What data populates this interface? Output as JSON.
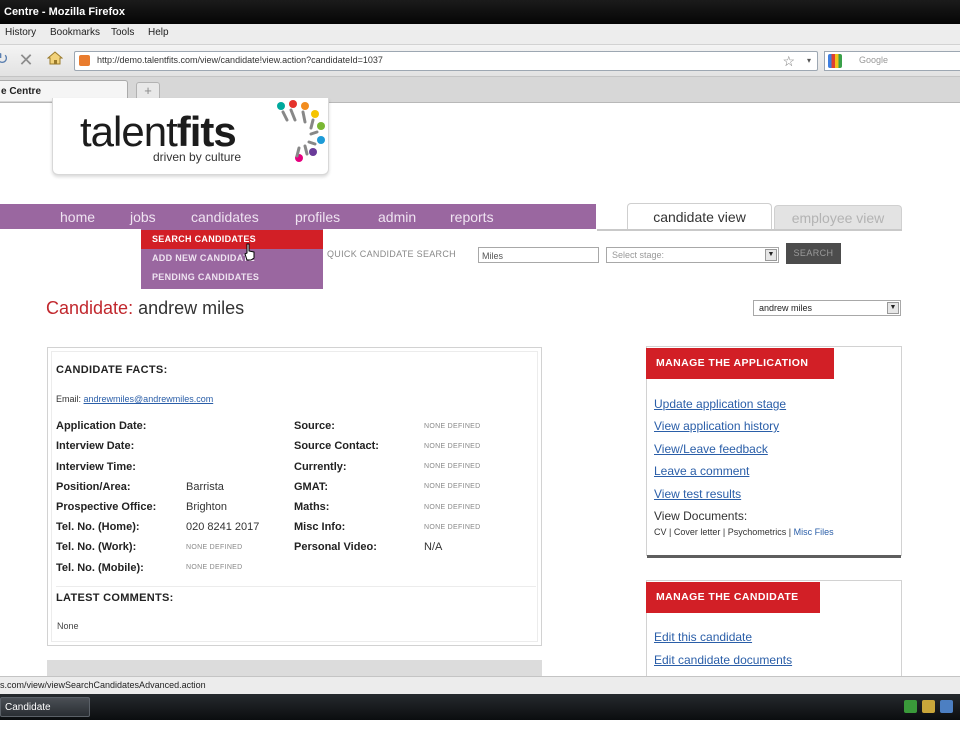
{
  "browser": {
    "title": "Centre - Mozilla Firefox",
    "menu": [
      "History",
      "Bookmarks",
      "Tools",
      "Help"
    ],
    "url": "http://demo.talentfits.com/view/candidate!view.action?candidateId=1037",
    "search_placeholder": "Google",
    "tab_label": "e Centre",
    "new_tab": "+",
    "status_text": "s.com/view/viewSearchCandidatesAdvanced.action",
    "taskbar_item": "Candidate Centre..."
  },
  "logo": {
    "name_light": "talent",
    "name_bold": "fits",
    "tagline": "driven by culture"
  },
  "nav": {
    "items": [
      "home",
      "jobs",
      "candidates",
      "profiles",
      "admin",
      "reports"
    ],
    "dropdown": [
      "SEARCH CANDIDATES",
      "ADD NEW CANDIDATE",
      "PENDING CANDIDATES"
    ]
  },
  "views": {
    "active": "candidate view",
    "inactive": "employee view"
  },
  "quick_search": {
    "label": "QUICK CANDIDATE SEARCH",
    "value": "Miles",
    "stage_placeholder": "Select stage:",
    "button": "SEARCH"
  },
  "candidate": {
    "label": "Candidate:",
    "name": "andrew miles",
    "selector_value": "andrew miles"
  },
  "facts": {
    "heading": "CANDIDATE FACTS:",
    "email_label": "Email:",
    "email": "andrewmiles@andrewmiles.com",
    "left": [
      {
        "label": "Application Date:",
        "value": ""
      },
      {
        "label": "Interview Date:",
        "value": ""
      },
      {
        "label": "Interview Time:",
        "value": ""
      },
      {
        "label": "Position/Area:",
        "value": "Barrista"
      },
      {
        "label": "Prospective Office:",
        "value": "Brighton"
      },
      {
        "label": "Tel. No. (Home):",
        "value": "020 8241 2017"
      },
      {
        "label": "Tel. No. (Work):",
        "value": "NONE DEFINED"
      },
      {
        "label": "Tel. No. (Mobile):",
        "value": "NONE DEFINED"
      }
    ],
    "right": [
      {
        "label": "Source:",
        "value": "NONE DEFINED"
      },
      {
        "label": "Source Contact:",
        "value": "NONE DEFINED"
      },
      {
        "label": "Currently:",
        "value": "NONE DEFINED"
      },
      {
        "label": "GMAT:",
        "value": "NONE DEFINED"
      },
      {
        "label": "Maths:",
        "value": "NONE DEFINED"
      },
      {
        "label": "Misc Info:",
        "value": "NONE DEFINED"
      },
      {
        "label": "Personal Video:",
        "value": "N/A"
      }
    ],
    "comments_heading": "LATEST COMMENTS:",
    "comments_value": "None"
  },
  "manage_application": {
    "heading": "MANAGE THE APPLICATION",
    "links": [
      "Update application stage",
      "View application history",
      "View/Leave feedback",
      "Leave a comment",
      "View test results"
    ],
    "docs_label": "View Documents:",
    "docs": [
      "CV",
      "Cover letter",
      "Psychometrics",
      "Misc Files"
    ],
    "docs_sep": " | "
  },
  "manage_candidate": {
    "heading": "MANAGE THE CANDIDATE",
    "links": [
      "Edit this candidate",
      "Edit candidate documents"
    ]
  },
  "colors": {
    "nav_purple": "#9a67a0",
    "accent_red": "#d21f26",
    "candidate_label_red": "#c1272d",
    "link_blue": "#2a5ea8"
  }
}
